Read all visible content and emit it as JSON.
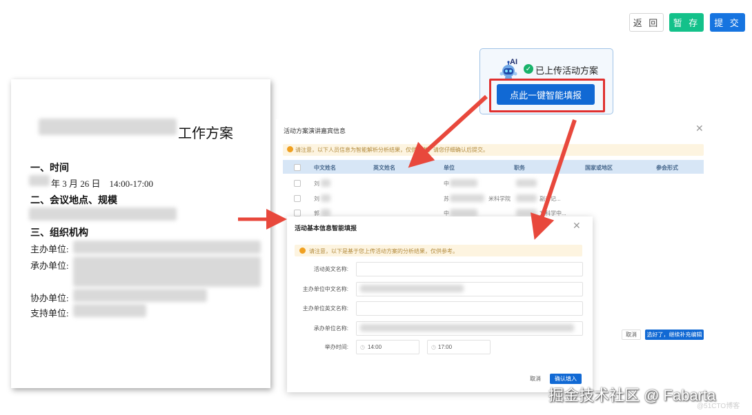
{
  "toolbar": {
    "back_label": "返 回",
    "save_label": "暂 存",
    "submit_label": "提 交",
    "save_color": "#13c18a",
    "submit_color": "#1674e0"
  },
  "ai_popup": {
    "ai_label": "AI",
    "uploaded_text": "已上传活动方案",
    "autofill_label": "点此一键智能填报",
    "highlight_color": "#e0302f",
    "icon": "robot-icon"
  },
  "document": {
    "title": "工作方案",
    "section1_heading": "一、时间",
    "section1_date": "年 3 月 26 日　14:00-17:00",
    "section2_heading": "二、会议地点、规模",
    "section3_heading": "三、组织机构",
    "host_label": "主办单位:",
    "organizer_label": "承办单位:",
    "co_organizer_label": "协办单位:",
    "support_label": "支持单位:"
  },
  "guest_dialog": {
    "title": "活动方案演讲嘉宾信息",
    "notice": "请注意，以下人员信息为智能解析分析结果，仅供参考，请您仔细确认后提交。",
    "columns": [
      "中文姓名",
      "英文姓名",
      "单位",
      "职务",
      "国家或地区",
      "参会形式"
    ],
    "rows": [
      {
        "name": "刘",
        "unit": "中",
        "title": ""
      },
      {
        "name": "刘",
        "unit": "苏",
        "unit_extra": "米科学院",
        "title": "副书记..."
      },
      {
        "name": "郭",
        "unit": "中",
        "title": "文科学中..."
      }
    ],
    "cancel_label": "取消",
    "confirm_label": "选好了，继续补充编辑"
  },
  "basic_dialog": {
    "title": "活动基本信息智能填报",
    "notice": "请注意，以下是基于您上传活动方案的分析结果，仅供参考。",
    "fields": {
      "event_en_name": "活动英文名称:",
      "host_cn_name": "主办单位中文名称:",
      "host_en_name": "主办单位英文名称:",
      "organizer_name": "承办单位名称:",
      "time": "举办时间:"
    },
    "start_time": "14:00",
    "end_time": "17:00",
    "cancel_label": "取消",
    "confirm_label": "确认填入"
  },
  "watermark": {
    "text": "掘金技术社区 @ Fabarta",
    "sub": "@51CTO博客"
  }
}
